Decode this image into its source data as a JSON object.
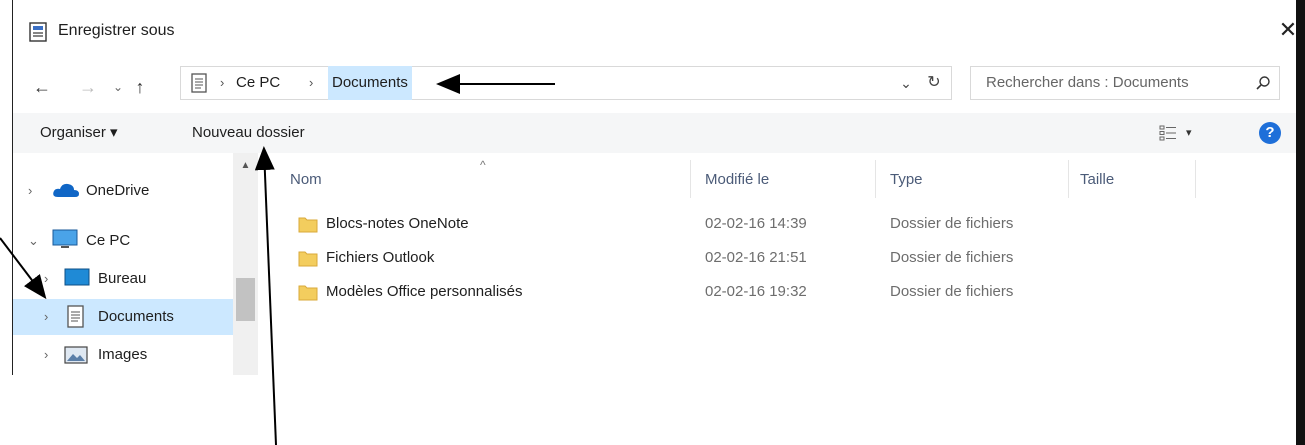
{
  "window": {
    "title": "Enregistrer sous",
    "close_glyph": "✕"
  },
  "nav": {
    "back": "←",
    "forward": "→",
    "recent": "⌄",
    "up": "↑"
  },
  "address": {
    "separator": "›",
    "crumbs": [
      {
        "label": "Ce PC"
      },
      {
        "label": "Documents"
      }
    ],
    "dropdown_glyph": "⌄",
    "refresh_glyph": "↻"
  },
  "search": {
    "placeholder": "Rechercher dans : Documents"
  },
  "toolbar": {
    "organize": "Organiser ▾",
    "new_folder": "Nouveau dossier",
    "view_arrow": "▾",
    "help": "?"
  },
  "sidebar": {
    "items": [
      {
        "label": "OneDrive",
        "chevron": "›",
        "icon": "cloud-icon"
      },
      {
        "label": "Ce PC",
        "chevron": "⌄",
        "icon": "computer-icon"
      },
      {
        "label": "Bureau",
        "chevron": "›",
        "icon": "desktop-icon"
      },
      {
        "label": "Documents",
        "chevron": "›",
        "icon": "document-icon",
        "selected": true
      },
      {
        "label": "Images",
        "chevron": "›",
        "icon": "image-icon"
      }
    ]
  },
  "columns": {
    "name": "Nom",
    "modified": "Modifié le",
    "type": "Type",
    "size": "Taille",
    "sort_glyph": "^"
  },
  "files": [
    {
      "name": "Blocs-notes OneNote",
      "modified": "02-02-16 14:39",
      "type": "Dossier de fichiers"
    },
    {
      "name": "Fichiers Outlook",
      "modified": "02-02-16 21:51",
      "type": "Dossier de fichiers"
    },
    {
      "name": "Modèles Office personnalisés",
      "modified": "02-02-16 19:32",
      "type": "Dossier de fichiers"
    }
  ],
  "colors": {
    "selection": "#cce8ff",
    "folder": "#f3cd5e",
    "help": "#1e6fd9",
    "onedrive": "#1066c6"
  }
}
